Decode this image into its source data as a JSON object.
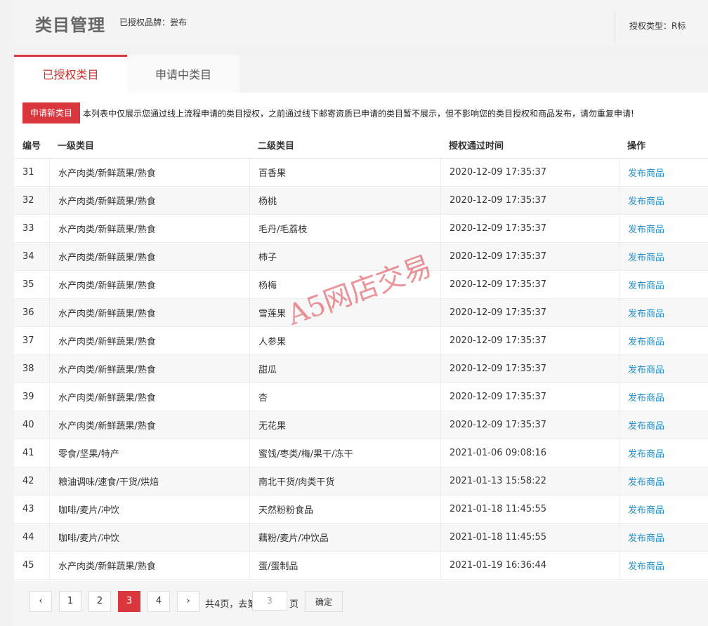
{
  "header": {
    "title": "类目管理",
    "brand": "已授权品牌：尝布",
    "auth_type": "授权类型：R标"
  },
  "tabs": [
    {
      "label": "已授权类目",
      "active": true
    },
    {
      "label": "申请中类目",
      "active": false
    }
  ],
  "notice": {
    "apply_button": "申请新类目",
    "text": "本列表中仅展示您通过线上流程申请的类目授权，之前通过线下邮寄资质已申请的类目暂不展示，但不影响您的类目授权和商品发布，请勿重复申请!"
  },
  "table": {
    "columns": [
      "编号",
      "一级类目",
      "二级类目",
      "授权通过时间",
      "操作"
    ],
    "rows": [
      {
        "no": "31",
        "level1": "水产肉类/新鲜蔬果/熟食",
        "level2": "百香果",
        "time": "2020-12-09 17:35:37",
        "op": "发布商品"
      },
      {
        "no": "32",
        "level1": "水产肉类/新鲜蔬果/熟食",
        "level2": "杨桃",
        "time": "2020-12-09 17:35:37",
        "op": "发布商品"
      },
      {
        "no": "33",
        "level1": "水产肉类/新鲜蔬果/熟食",
        "level2": "毛丹/毛荔枝",
        "time": "2020-12-09 17:35:37",
        "op": "发布商品"
      },
      {
        "no": "34",
        "level1": "水产肉类/新鲜蔬果/熟食",
        "level2": "柿子",
        "time": "2020-12-09 17:35:37",
        "op": "发布商品"
      },
      {
        "no": "35",
        "level1": "水产肉类/新鲜蔬果/熟食",
        "level2": "杨梅",
        "time": "2020-12-09 17:35:37",
        "op": "发布商品"
      },
      {
        "no": "36",
        "level1": "水产肉类/新鲜蔬果/熟食",
        "level2": "雪莲果",
        "time": "2020-12-09 17:35:37",
        "op": "发布商品"
      },
      {
        "no": "37",
        "level1": "水产肉类/新鲜蔬果/熟食",
        "level2": "人参果",
        "time": "2020-12-09 17:35:37",
        "op": "发布商品"
      },
      {
        "no": "38",
        "level1": "水产肉类/新鲜蔬果/熟食",
        "level2": "甜瓜",
        "time": "2020-12-09 17:35:37",
        "op": "发布商品"
      },
      {
        "no": "39",
        "level1": "水产肉类/新鲜蔬果/熟食",
        "level2": "杏",
        "time": "2020-12-09 17:35:37",
        "op": "发布商品"
      },
      {
        "no": "40",
        "level1": "水产肉类/新鲜蔬果/熟食",
        "level2": "无花果",
        "time": "2020-12-09 17:35:37",
        "op": "发布商品"
      },
      {
        "no": "41",
        "level1": "零食/坚果/特产",
        "level2": "蜜饯/枣类/梅/果干/冻干",
        "time": "2021-01-06 09:08:16",
        "op": "发布商品"
      },
      {
        "no": "42",
        "level1": "粮油调味/速食/干货/烘焙",
        "level2": "南北干货/肉类干货",
        "time": "2021-01-13 15:58:22",
        "op": "发布商品"
      },
      {
        "no": "43",
        "level1": "咖啡/麦片/冲饮",
        "level2": "天然粉粉食品",
        "time": "2021-01-18 11:45:55",
        "op": "发布商品"
      },
      {
        "no": "44",
        "level1": "咖啡/麦片/冲饮",
        "level2": "藕粉/麦片/冲饮品",
        "time": "2021-01-18 11:45:55",
        "op": "发布商品"
      },
      {
        "no": "45",
        "level1": "水产肉类/新鲜蔬果/熟食",
        "level2": "蛋/蛋制品",
        "time": "2021-01-19 16:36:44",
        "op": "发布商品"
      }
    ]
  },
  "pager": {
    "prev": "‹",
    "next": "›",
    "pages": [
      "1",
      "2",
      "3",
      "4"
    ],
    "current": "3",
    "total_prefix": "共4页，去第",
    "input_value": "3",
    "suffix": "页",
    "confirm": "确定"
  },
  "watermark": "A5网店交易",
  "colors": {
    "accent": "#d9363e",
    "link": "#2a8fcc"
  }
}
